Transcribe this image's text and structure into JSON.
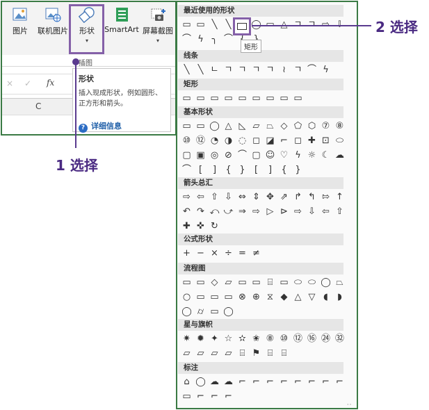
{
  "ribbon": {
    "buttons": [
      {
        "label": "图片",
        "icon": "picture-icon"
      },
      {
        "label": "联机图片",
        "icon": "online-picture-icon"
      },
      {
        "label": "形状",
        "icon": "shapes-icon"
      },
      {
        "label": "SmartArt",
        "icon": "smartart-icon"
      },
      {
        "label": "屏幕截图",
        "icon": "screenshot-icon"
      }
    ],
    "group_label": "插图",
    "formula_bar": {
      "cancel": "×",
      "confirm": "✓",
      "fx": "fx"
    },
    "column_header": "C"
  },
  "tooltip1": {
    "title": "形状",
    "description": "插入现成形状，例如圆形、正方形和箭头。",
    "more_info": "详细信息"
  },
  "callouts": {
    "one": "1 选择",
    "two": "2 选择"
  },
  "gallery": {
    "sections": [
      {
        "title": "最近使用的形状",
        "rows": [
          [
            "▭",
            "▭",
            "╲",
            "╲",
            "▭",
            "◯",
            "▭",
            "△",
            "ㄱ",
            "ㄱ",
            "⇨",
            "⇩"
          ],
          [
            "⌒",
            "ϟ",
            "╮",
            "⌒",
            "{",
            "}"
          ]
        ]
      },
      {
        "title": "线条",
        "rows": [
          [
            "╲",
            "╲",
            "ㄴ",
            "ㄱ",
            "ㄱ",
            "ㄱ",
            "ㄱ",
            "≀",
            "ㄱ",
            "⌒",
            "ϟ"
          ]
        ]
      },
      {
        "title": "矩形",
        "rows": [
          [
            "▭",
            "▭",
            "▭",
            "▭",
            "▭",
            "▭",
            "▭",
            "▭",
            "▭"
          ]
        ]
      },
      {
        "title": "基本形状",
        "rows": [
          [
            "▭",
            "▭",
            "◯",
            "△",
            "◺",
            "▱",
            "⏢",
            "◇",
            "⬠",
            "⬡",
            "⑦",
            "⑧"
          ],
          [
            "⑩",
            "⑫",
            "◔",
            "◑",
            "◌",
            "◻",
            "◪",
            "⌐",
            "◻",
            "✚",
            "⊡",
            "⬭"
          ],
          [
            "▢",
            "▣",
            "◎",
            "⊘",
            "⌒",
            "▢",
            "☺",
            "♡",
            "ϟ",
            "☼",
            "☾",
            "☁"
          ],
          [
            "⌒",
            "[",
            "]",
            "{",
            "}",
            "[",
            "]",
            "{",
            "}"
          ]
        ]
      },
      {
        "title": "箭头总汇",
        "rows": [
          [
            "⇨",
            "⇦",
            "⇧",
            "⇩",
            "⇔",
            "⇕",
            "✥",
            "⇗",
            "↱",
            "↰",
            "⇰",
            "↑"
          ],
          [
            "↶",
            "↷",
            "⤺",
            "⤻",
            "⇒",
            "⇨",
            "▷",
            "⊳",
            "⇨",
            "⇩",
            "⇦",
            "⇧"
          ],
          [
            "✚",
            "✜",
            "↻"
          ]
        ]
      },
      {
        "title": "公式形状",
        "rows": [
          [
            "+",
            "−",
            "×",
            "÷",
            "=",
            "≠"
          ]
        ]
      },
      {
        "title": "流程图",
        "rows": [
          [
            "▭",
            "▭",
            "◇",
            "▱",
            "▭",
            "▭",
            "⌸",
            "▭",
            "⬭",
            "⬭",
            "◯",
            "⏢"
          ],
          [
            "○",
            "▭",
            "▭",
            "▭",
            "⊗",
            "⊕",
            "⧖",
            "◆",
            "△",
            "▽",
            "◖",
            "◗"
          ],
          [
            "◯",
            "⌭",
            "▭",
            "◯"
          ]
        ]
      },
      {
        "title": "星与旗帜",
        "rows": [
          [
            "✷",
            "✹",
            "✦",
            "☆",
            "✫",
            "✬",
            "⑧",
            "⑩",
            "⑫",
            "⑯",
            "㉔",
            "㉜"
          ],
          [
            "▱",
            "▱",
            "▱",
            "▱",
            "⌸",
            "⚑",
            "⌸",
            "⌸"
          ]
        ]
      },
      {
        "title": "标注",
        "rows": [
          [
            "⌂",
            "◯",
            "☁",
            "☁",
            "⌐",
            "⌐",
            "⌐",
            "⌐",
            "⌐",
            "⌐",
            "⌐",
            "⌐"
          ],
          [
            "▭",
            "⌐",
            "⌐",
            "⌐"
          ]
        ]
      }
    ],
    "selected_shape_tooltip": "矩形"
  }
}
